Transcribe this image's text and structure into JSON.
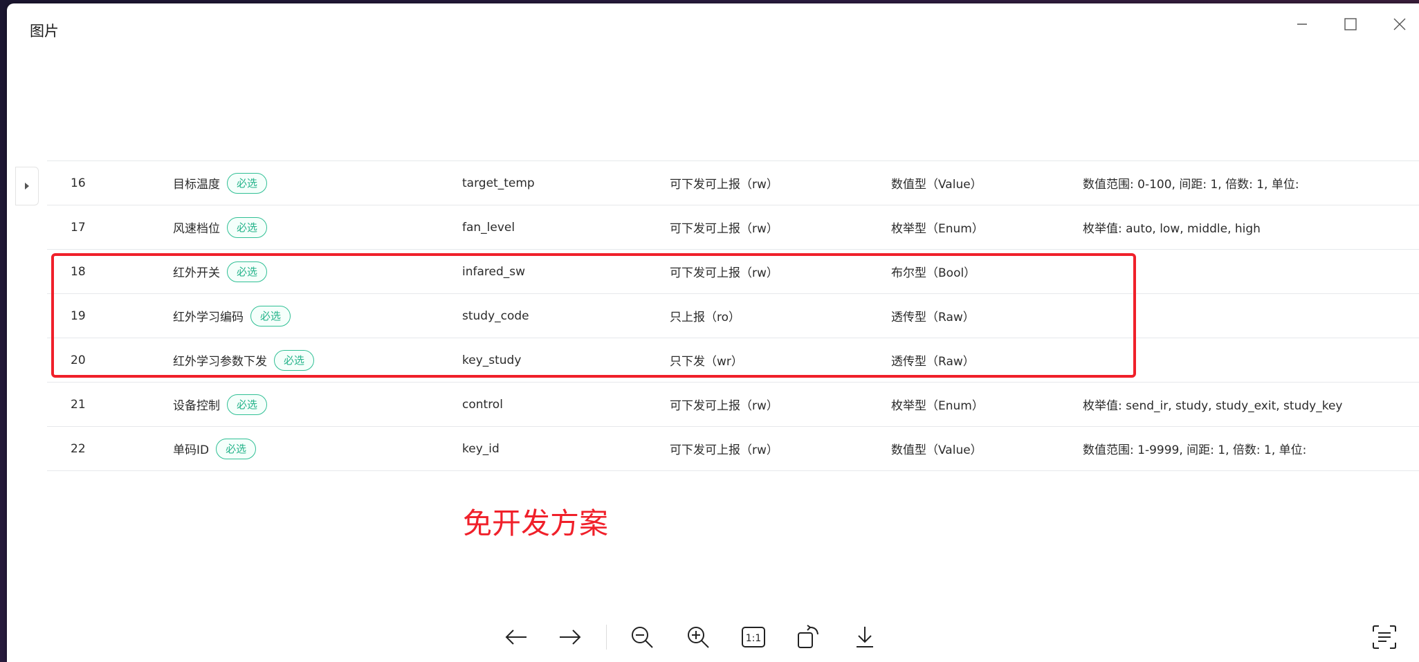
{
  "window": {
    "title": "图片"
  },
  "table": {
    "rows": [
      {
        "index": "16",
        "name": "目标温度",
        "tag": "必选",
        "identifier": "target_temp",
        "mode": "可下发可上报（rw）",
        "type": "数值型（Value）",
        "spec": "数值范围: 0-100, 间距: 1, 倍数: 1, 单位:"
      },
      {
        "index": "17",
        "name": "风速档位",
        "tag": "必选",
        "identifier": "fan_level",
        "mode": "可下发可上报（rw）",
        "type": "枚举型（Enum）",
        "spec": "枚举值: auto, low, middle, high"
      },
      {
        "index": "18",
        "name": "红外开关",
        "tag": "必选",
        "identifier": "infared_sw",
        "mode": "可下发可上报（rw）",
        "type": "布尔型（Bool）",
        "spec": ""
      },
      {
        "index": "19",
        "name": "红外学习编码",
        "tag": "必选",
        "identifier": "study_code",
        "mode": "只上报（ro）",
        "type": "透传型（Raw）",
        "spec": ""
      },
      {
        "index": "20",
        "name": "红外学习参数下发",
        "tag": "必选",
        "identifier": "key_study",
        "mode": "只下发（wr）",
        "type": "透传型（Raw）",
        "spec": ""
      },
      {
        "index": "21",
        "name": "设备控制",
        "tag": "必选",
        "identifier": "control",
        "mode": "可下发可上报（rw）",
        "type": "枚举型（Enum）",
        "spec": "枚举值: send_ir, study, study_exit, study_key"
      },
      {
        "index": "22",
        "name": "单码ID",
        "tag": "必选",
        "identifier": "key_id",
        "mode": "可下发可上报（rw）",
        "type": "数值型（Value）",
        "spec": "数值范围: 1-9999, 间距: 1, 倍数: 1, 单位:"
      }
    ]
  },
  "annotation": {
    "text": "免开发方案",
    "color": "#f0202a"
  },
  "colors": {
    "tag_green": "#24b38a",
    "highlight_red": "#f0202a"
  },
  "toolbar": {
    "icons": [
      "arrow-left-icon",
      "arrow-right-icon",
      "zoom-out-icon",
      "zoom-in-icon",
      "actual-size-icon",
      "rotate-icon",
      "download-icon",
      "text-recognition-icon"
    ],
    "actual_size_label": "1:1"
  }
}
